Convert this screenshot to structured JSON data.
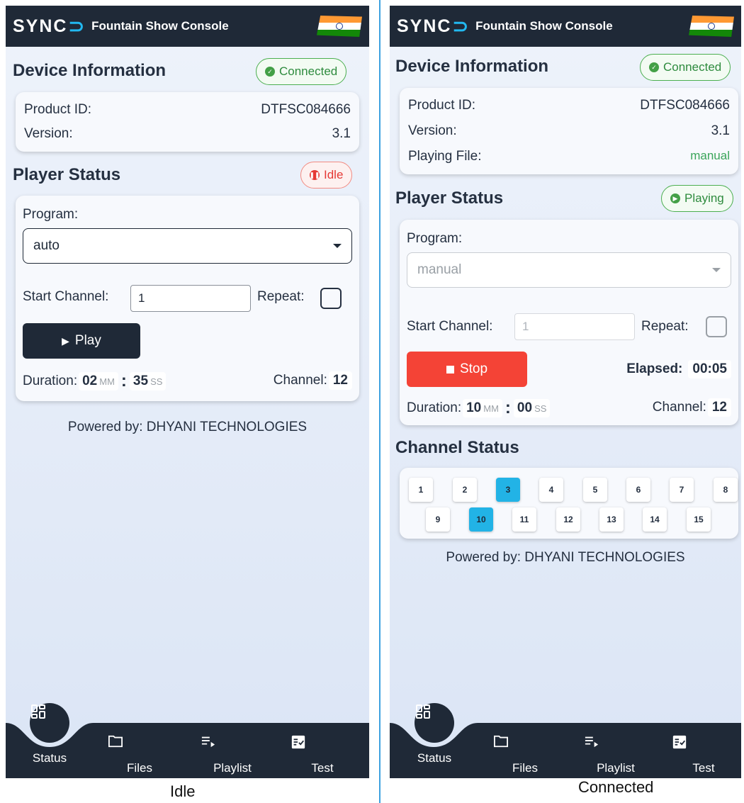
{
  "app": {
    "logo": "SYNC",
    "logo_accent": "⊃",
    "title": "Fountain Show Console"
  },
  "idle": {
    "device": {
      "title": "Device Information",
      "badge": "Connected",
      "product_id_label": "Product ID:",
      "product_id": "DTFSC084666",
      "version_label": "Version:",
      "version": "3.1"
    },
    "player": {
      "title": "Player Status",
      "badge": "Idle",
      "program_label": "Program:",
      "program": "auto",
      "start_channel_label": "Start Channel:",
      "start_channel": "1",
      "repeat_label": "Repeat:",
      "play_label": "Play",
      "duration_label": "Duration:",
      "mm": "02",
      "mm_unit": "MM",
      "ss": "35",
      "ss_unit": "SS",
      "channel_label": "Channel:",
      "channel": "12"
    },
    "powered": "Powered by: DHYANI TECHNOLOGIES",
    "caption": "Idle"
  },
  "connected": {
    "device": {
      "title": "Device Information",
      "badge": "Connected",
      "product_id_label": "Product ID:",
      "product_id": "DTFSC084666",
      "version_label": "Version:",
      "version": "3.1",
      "playing_file_label": "Playing File:",
      "playing_file": "manual"
    },
    "player": {
      "title": "Player Status",
      "badge": "Playing",
      "program_label": "Program:",
      "program": "manual",
      "start_channel_label": "Start Channel:",
      "start_channel": "1",
      "repeat_label": "Repeat:",
      "stop_label": "Stop",
      "elapsed_label": "Elapsed:",
      "elapsed": "00:05",
      "duration_label": "Duration:",
      "mm": "10",
      "mm_unit": "MM",
      "ss": "00",
      "ss_unit": "SS",
      "channel_label": "Channel:",
      "channel": "12"
    },
    "channel_status": {
      "title": "Channel Status",
      "channels": [
        "1",
        "2",
        "3",
        "4",
        "5",
        "6",
        "7",
        "8",
        "9",
        "10",
        "11",
        "12",
        "13",
        "14",
        "15"
      ],
      "active": [
        "3",
        "10"
      ]
    },
    "powered": "Powered by: DHYANI TECHNOLOGIES",
    "caption": "Connected"
  },
  "nav": {
    "items": [
      {
        "label": "Status",
        "icon": "dashboard-icon"
      },
      {
        "label": "Files",
        "icon": "folder-icon"
      },
      {
        "label": "Playlist",
        "icon": "playlist-play-icon"
      },
      {
        "label": "Test",
        "icon": "fact-check-icon"
      }
    ]
  },
  "colors": {
    "dark": "#1f2937",
    "accent": "#22b8f0",
    "connected": "#4caf50",
    "idle": "#e53935",
    "stop": "#f44336"
  }
}
